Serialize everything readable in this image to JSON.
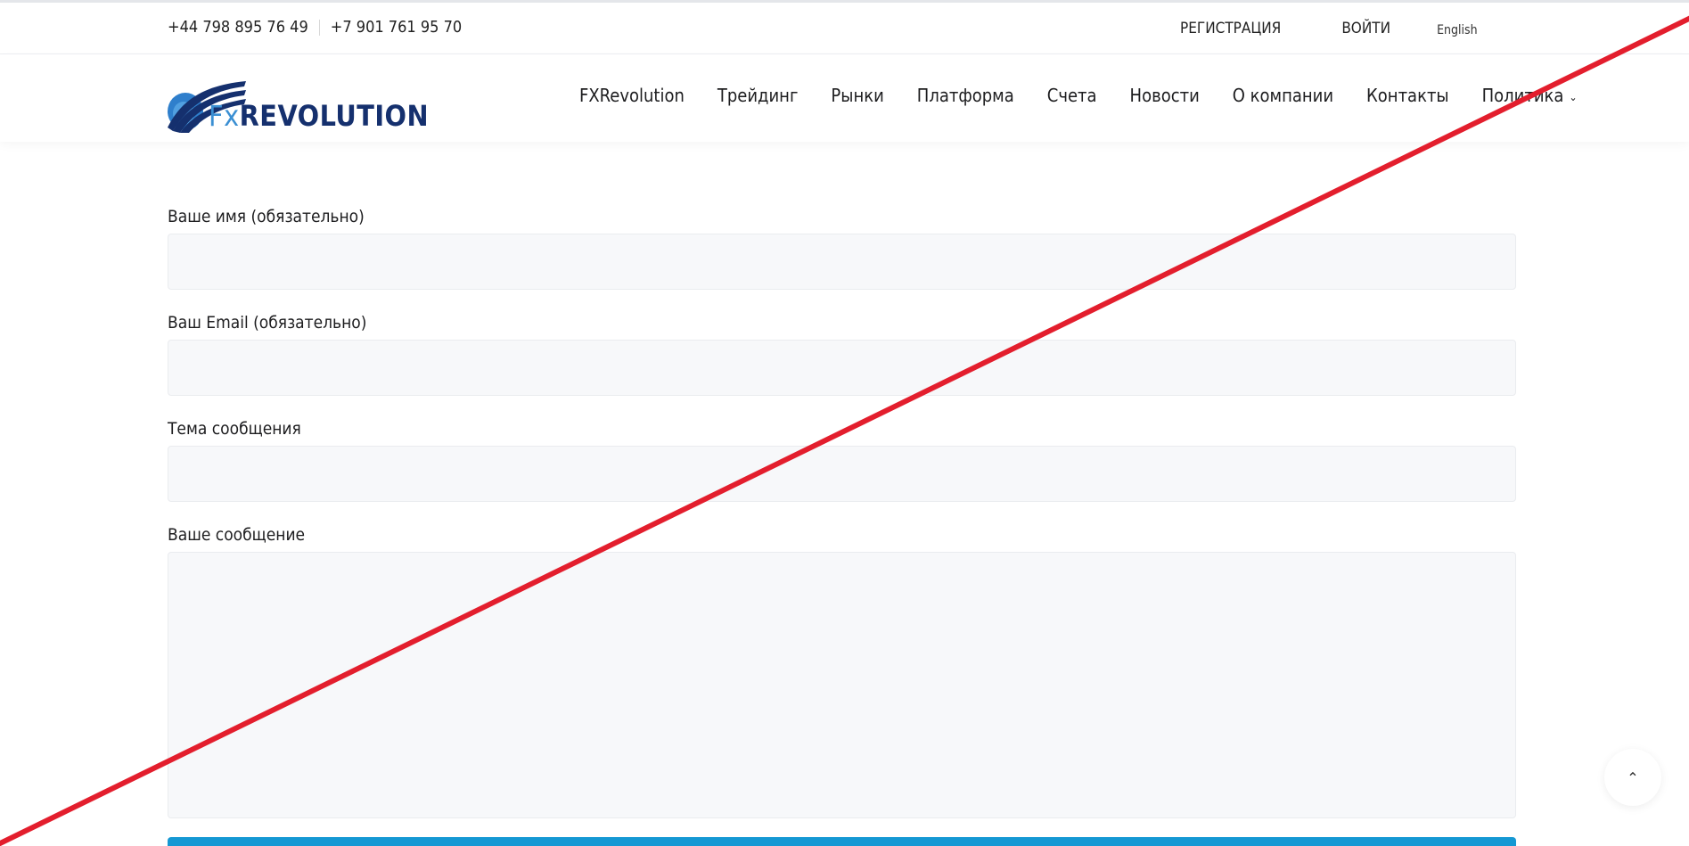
{
  "topbar": {
    "phone_1": "+44 798 895 76 49",
    "phone_2": "+7 901 761 95 70",
    "register": "РЕГИСТРАЦИЯ",
    "login": "ВОЙТИ",
    "language": "English"
  },
  "header": {
    "logo": {
      "fx": "Fx",
      "rest": "REVOLUTION"
    },
    "nav": [
      {
        "label": "FXRevolution"
      },
      {
        "label": "Трейдинг"
      },
      {
        "label": "Рынки"
      },
      {
        "label": "Платформа"
      },
      {
        "label": "Счета"
      },
      {
        "label": "Новости"
      },
      {
        "label": "О компании"
      },
      {
        "label": "Контакты"
      },
      {
        "label": "Политика"
      }
    ],
    "chevron_icon": "chevron-down-icon"
  },
  "form": {
    "name_label": "Ваше имя (обязательно)",
    "name_value": "",
    "email_label": "Ваш Email (обязательно)",
    "email_value": "",
    "subject_label": "Тема сообщения",
    "subject_value": "",
    "message_label": "Ваше сообщение",
    "message_value": ""
  },
  "scroll_top": {
    "glyph": "⌃",
    "icon": "chevron-up-icon"
  },
  "colors": {
    "brand_dark": "#15306e",
    "brand_light": "#3a8fd3",
    "button": "#1598d3",
    "strike": "#e31e2d",
    "field_bg": "#f7f8fa"
  }
}
